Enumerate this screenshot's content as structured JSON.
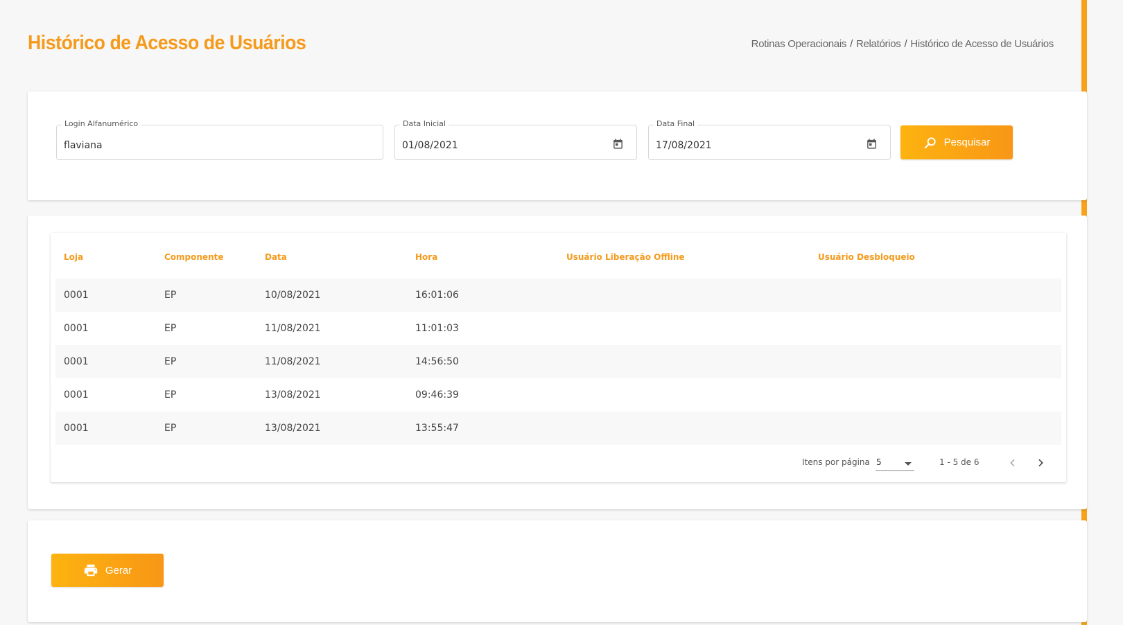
{
  "header": {
    "title": "Histórico de Acesso de Usuários",
    "breadcrumb": [
      "Rotinas Operacionais",
      "Relatórios",
      "Histórico de Acesso de Usuários"
    ],
    "breadcrumb_separator": "/"
  },
  "filters": {
    "login": {
      "label": "Login Alfanumérico",
      "value": "flaviana"
    },
    "start_date": {
      "label": "Data Inicial",
      "value": "01/08/2021",
      "icon": "calendar-icon"
    },
    "end_date": {
      "label": "Data Final",
      "value": "17/08/2021",
      "icon": "calendar-icon"
    },
    "search_button": {
      "label": "Pesquisar",
      "icon": "search-icon"
    }
  },
  "table": {
    "columns": [
      "Loja",
      "Componente",
      "Data",
      "Hora",
      "Usuário Liberação Offline",
      "Usuário Desbloqueio"
    ],
    "rows": [
      [
        "0001",
        "EP",
        "10/08/2021",
        "16:01:06",
        "",
        ""
      ],
      [
        "0001",
        "EP",
        "11/08/2021",
        "11:01:03",
        "",
        ""
      ],
      [
        "0001",
        "EP",
        "11/08/2021",
        "14:56:50",
        "",
        ""
      ],
      [
        "0001",
        "EP",
        "13/08/2021",
        "09:46:39",
        "",
        ""
      ],
      [
        "0001",
        "EP",
        "13/08/2021",
        "13:55:47",
        "",
        ""
      ]
    ],
    "paginator": {
      "items_per_page_label": "Itens por página",
      "items_per_page_value": "5",
      "range_label": "1 - 5 de 6"
    }
  },
  "actions": {
    "generate_button": {
      "label": "Gerar",
      "icon": "printer-icon"
    }
  },
  "colors": {
    "accent": "#f59a1b",
    "button_start": "#fdb310",
    "button_end": "#f89716"
  }
}
